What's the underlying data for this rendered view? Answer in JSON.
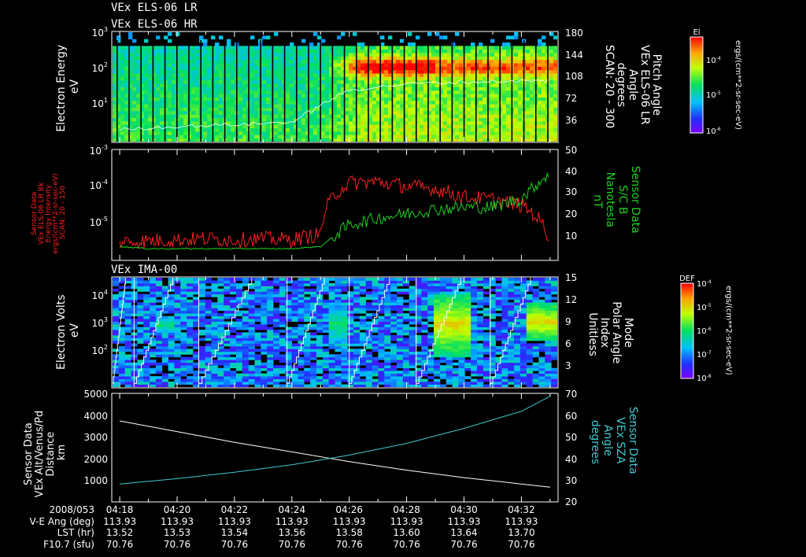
{
  "titles": {
    "line1": "VEx ELS-06 LR",
    "line2": "VEx ELS-06 HR"
  },
  "panels": {
    "p1": {
      "ylabel": [
        "Electron Energy",
        "eV"
      ],
      "yticks": [
        {
          "b": "10",
          "e": "1"
        },
        {
          "b": "10",
          "e": "2"
        },
        {
          "b": "10",
          "e": "3"
        }
      ],
      "right_ticks": [
        "36",
        "72",
        "108",
        "144",
        "180"
      ],
      "right_label": [
        "Pitch Angle",
        "VEx ELS-06 LR",
        "Angle",
        "degrees",
        "SCAN: 20 - 300"
      ],
      "colorbar": {
        "title": "El",
        "units": "ergs/(cm**2-sr-sec-eV)",
        "ticks": [
          {
            "b": "10",
            "e": "-4"
          },
          {
            "b": "10",
            "e": "-5"
          },
          {
            "b": "10",
            "e": "-6"
          }
        ]
      }
    },
    "p2": {
      "yticks_left": [
        {
          "b": "10",
          "e": "-5"
        },
        {
          "b": "10",
          "e": "-4"
        },
        {
          "b": "10",
          "e": "-3"
        }
      ],
      "left_label": [
        "Sensor Data",
        "VEx ELS-06 LR Bk",
        "Energy Intensity",
        "ergs/(cm**2-sr-sec-eV)",
        "SCAN: 20 - 150"
      ],
      "right_ticks": [
        "10",
        "20",
        "30",
        "40",
        "50"
      ],
      "right_label": [
        "Sensor Data",
        "S/C B",
        "Nanotesla",
        "nT"
      ]
    },
    "p3": {
      "title": "VEx IMA-00",
      "ylabel": [
        "Electron Volts",
        "eV"
      ],
      "yticks": [
        {
          "b": "10",
          "e": "2"
        },
        {
          "b": "10",
          "e": "3"
        },
        {
          "b": "10",
          "e": "4"
        }
      ],
      "right_ticks": [
        "3",
        "6",
        "9",
        "12",
        "15"
      ],
      "right_label": [
        "Mode",
        "Polar Angle",
        "Index",
        "Unitless"
      ],
      "colorbar": {
        "title": "DEF",
        "units": "ergs/(cm**2-sr-sec-eV)",
        "ticks": [
          {
            "b": "10",
            "e": "-4"
          },
          {
            "b": "10",
            "e": "-5"
          },
          {
            "b": "10",
            "e": "-6"
          },
          {
            "b": "10",
            "e": "-7"
          },
          {
            "b": "10",
            "e": "-8"
          }
        ]
      }
    },
    "p4": {
      "yticks_left": [
        "1000",
        "2000",
        "3000",
        "4000",
        "5000"
      ],
      "left_label": [
        "Sensor Data",
        "VEx Alt/Venus/Pd",
        "Distance",
        "km"
      ],
      "right_ticks": [
        "20",
        "30",
        "40",
        "50",
        "60",
        "70"
      ],
      "right_label": [
        "Sensor Data",
        "VEx SZA",
        "Angle",
        "degrees"
      ]
    }
  },
  "footer": {
    "rows": [
      {
        "label": "2008/053",
        "values": [
          "04:18",
          "04:20",
          "04:22",
          "04:24",
          "04:26",
          "04:28",
          "04:30",
          "04:32"
        ]
      },
      {
        "label": "V-E Ang (deg)",
        "values": [
          "113.93",
          "113.93",
          "113.93",
          "113.93",
          "113.93",
          "113.93",
          "113.93",
          "113.93"
        ]
      },
      {
        "label": "LST (hr)",
        "values": [
          "13.52",
          "13.53",
          "13.54",
          "13.56",
          "13.58",
          "13.60",
          "13.64",
          "13.70"
        ]
      },
      {
        "label": "F10.7 (sfu)",
        "values": [
          "70.76",
          "70.76",
          "70.76",
          "70.76",
          "70.76",
          "70.76",
          "70.76",
          "70.76"
        ]
      }
    ]
  },
  "chart_data": [
    {
      "type": "heatmap",
      "x_range": [
        "04:17:45",
        "04:33:15"
      ],
      "y_scale": "log",
      "ylim": [
        1,
        1000
      ],
      "y2lim": [
        0,
        180
      ],
      "color_scale": "log",
      "clim": [
        1e-06,
        0.0001
      ],
      "overlay_pitch_angle": {
        "x": [
          "04:18",
          "04:20",
          "04:22",
          "04:24",
          "04:25",
          "04:26",
          "04:28",
          "04:30",
          "04:32",
          "04:33"
        ],
        "y": [
          20,
          25,
          28,
          32,
          60,
          85,
          95,
          98,
          100,
          100
        ]
      }
    },
    {
      "type": "line",
      "x": [
        "04:18",
        "04:19",
        "04:20",
        "04:21",
        "04:22",
        "04:23",
        "04:24",
        "04:25",
        "04:26",
        "04:27",
        "04:28",
        "04:29",
        "04:30",
        "04:31",
        "04:32",
        "04:33"
      ],
      "series": [
        {
          "name": "Energy Intensity",
          "color": "#ff2020",
          "axis": "left",
          "y_scale": "log",
          "ylim": [
            3.16e-06,
            0.001
          ],
          "values": [
            8e-06,
            8.5e-06,
            9e-06,
            9.5e-06,
            9e-06,
            9.5e-06,
            9e-06,
            1.2e-05,
            0.00018,
            0.00019,
            0.00015,
            0.00013,
            8.5e-05,
            7.5e-05,
            5.5e-05,
            8e-06
          ]
        },
        {
          "name": "S/C B",
          "color": "#20d020",
          "axis": "right",
          "ylim": [
            0,
            50
          ],
          "values": [
            6,
            5,
            5,
            5,
            5,
            5,
            5,
            6,
            16,
            19,
            21,
            23,
            24,
            24,
            28,
            40
          ]
        }
      ]
    },
    {
      "type": "heatmap",
      "x_range": [
        "04:17:45",
        "04:33:15"
      ],
      "y_scale": "log",
      "ylim": [
        10,
        31623
      ],
      "y2lim": [
        0,
        15
      ],
      "color_scale": "log",
      "clim": [
        1e-08,
        0.0001
      ],
      "scan_boundaries": [
        "04:18:30",
        "04:20:45",
        "04:23:50",
        "04:26:00",
        "04:28:20",
        "04:30:55"
      ],
      "hot_patches": [
        {
          "x": [
            "04:29:00",
            "04:30:20"
          ],
          "y": [
            100,
            10000
          ],
          "level": 1e-05
        },
        {
          "x": [
            "04:32:15",
            "04:33:15"
          ],
          "y": [
            300,
            5000
          ],
          "level": 1e-05
        },
        {
          "x": [
            "04:19:20",
            "04:20:00"
          ],
          "y": [
            500,
            2000
          ],
          "level": 1e-06
        },
        {
          "x": [
            "04:25:20",
            "04:26:00"
          ],
          "y": [
            200,
            5000
          ],
          "level": 1e-06
        }
      ]
    },
    {
      "type": "line",
      "x": [
        "04:18",
        "04:20",
        "04:22",
        "04:24",
        "04:26",
        "04:28",
        "04:30",
        "04:32",
        "04:33"
      ],
      "series": [
        {
          "name": "Distance",
          "color": "#ffffff",
          "axis": "left",
          "ylim": [
            0,
            5000
          ],
          "values": [
            3750,
            3250,
            2750,
            2300,
            1850,
            1450,
            1100,
            800,
            650
          ]
        },
        {
          "name": "SZA",
          "color": "#40c8d0",
          "axis": "right",
          "ylim": [
            20,
            70
          ],
          "values": [
            28,
            30.5,
            33.5,
            37,
            41.5,
            47,
            54,
            62,
            69
          ]
        }
      ]
    }
  ],
  "colors": {
    "red": "#ff2020",
    "green": "#20d020",
    "cyan": "#40c8d0"
  }
}
